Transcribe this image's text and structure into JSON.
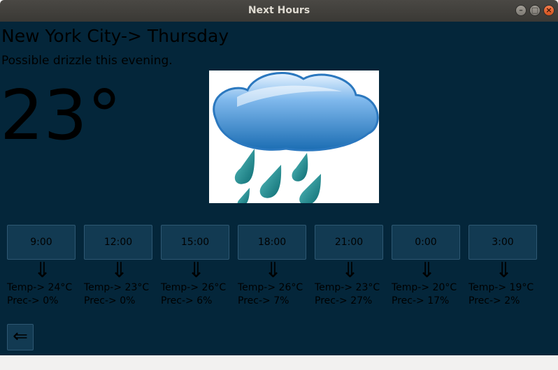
{
  "window": {
    "title": "Next Hours",
    "minimize_glyph": "–",
    "maximize_glyph": "□",
    "close_glyph": "×"
  },
  "header": {
    "city_day": "New York City-> Thursday",
    "description": "Possible drizzle this evening.",
    "temperature": "23°",
    "weather_icon": "rain-cloud-icon"
  },
  "hours": [
    {
      "time": "9:00",
      "arrow": "⇓",
      "temp": "Temp-> 24°C",
      "prec": "Prec-> 0%"
    },
    {
      "time": "12:00",
      "arrow": "⇓",
      "temp": "Temp-> 23°C",
      "prec": "Prec-> 0%"
    },
    {
      "time": "15:00",
      "arrow": "⇓",
      "temp": "Temp-> 26°C",
      "prec": "Prec-> 6%"
    },
    {
      "time": "18:00",
      "arrow": "⇓",
      "temp": "Temp-> 26°C",
      "prec": "Prec-> 7%"
    },
    {
      "time": "21:00",
      "arrow": "⇓",
      "temp": "Temp-> 23°C",
      "prec": "Prec-> 27%"
    },
    {
      "time": "0:00",
      "arrow": "⇓",
      "temp": "Temp-> 20°C",
      "prec": "Prec-> 17%"
    },
    {
      "time": "3:00",
      "arrow": "⇓",
      "temp": "Temp-> 19°C",
      "prec": "Prec-> 2%"
    }
  ],
  "back_button": {
    "glyph": "⇐",
    "icon": "back-arrow-icon"
  },
  "colors": {
    "background": "#04263a",
    "button": "#123a52",
    "button_border": "#2e5873",
    "text": "#000000"
  }
}
